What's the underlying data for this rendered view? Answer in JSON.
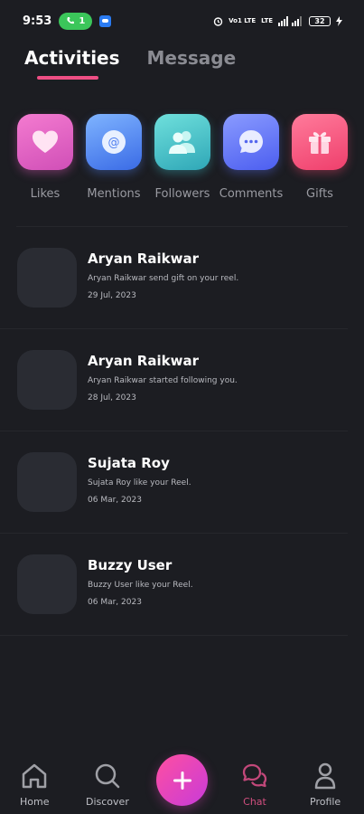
{
  "status_bar": {
    "time": "9:53",
    "call_count": "1",
    "network_1": "Vo1 LTE",
    "network_2": "LTE",
    "battery": "32"
  },
  "tabs": [
    {
      "label": "Activities",
      "active": true
    },
    {
      "label": "Message",
      "active": false
    }
  ],
  "categories": [
    {
      "label": "Likes",
      "icon": "heart-icon"
    },
    {
      "label": "Mentions",
      "icon": "at-icon"
    },
    {
      "label": "Followers",
      "icon": "users-icon"
    },
    {
      "label": "Comments",
      "icon": "chat-bubble-icon"
    },
    {
      "label": "Gifts",
      "icon": "gift-icon"
    }
  ],
  "activities": [
    {
      "name": "Aryan Raikwar",
      "desc": "Aryan Raikwar send gift on your reel.",
      "date": "29 Jul, 2023"
    },
    {
      "name": "Aryan Raikwar",
      "desc": "Aryan Raikwar started following you.",
      "date": "28 Jul, 2023"
    },
    {
      "name": "Sujata Roy",
      "desc": "Sujata Roy like your Reel.",
      "date": "06 Mar, 2023"
    },
    {
      "name": "Buzzy User",
      "desc": "Buzzy User like your Reel.",
      "date": "06 Mar, 2023"
    }
  ],
  "bottom_nav": [
    {
      "label": "Home",
      "icon": "home-icon"
    },
    {
      "label": "Discover",
      "icon": "search-icon"
    },
    {
      "label": "Chat",
      "icon": "chat-icon",
      "active": true
    },
    {
      "label": "Profile",
      "icon": "profile-icon"
    }
  ],
  "colors": {
    "background": "#1c1d22",
    "accent": "#ee4e84",
    "active_nav": "#d14f7f"
  }
}
